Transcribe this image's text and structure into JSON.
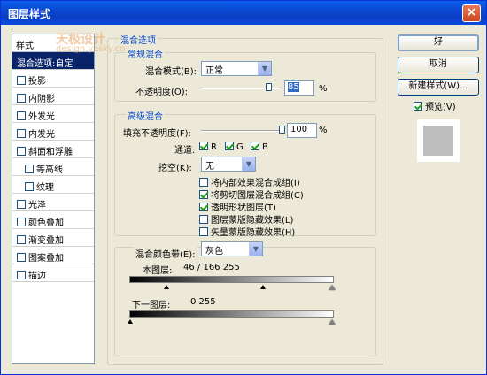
{
  "window": {
    "title": "图层样式",
    "close": "×"
  },
  "watermark": {
    "line1": "天极设计",
    "line2": "design.yesky.com"
  },
  "styles_panel": {
    "header": "样式",
    "items": [
      {
        "label": "混合选项:自定",
        "checkbox": false,
        "selected": true,
        "sub": false
      },
      {
        "label": "投影",
        "checkbox": true,
        "checked": false,
        "sub": false
      },
      {
        "label": "内阴影",
        "checkbox": true,
        "checked": false,
        "sub": false
      },
      {
        "label": "外发光",
        "checkbox": true,
        "checked": false,
        "sub": false
      },
      {
        "label": "内发光",
        "checkbox": true,
        "checked": false,
        "sub": false
      },
      {
        "label": "斜面和浮雕",
        "checkbox": true,
        "checked": false,
        "sub": false
      },
      {
        "label": "等高线",
        "checkbox": true,
        "checked": false,
        "sub": true
      },
      {
        "label": "纹理",
        "checkbox": true,
        "checked": false,
        "sub": true
      },
      {
        "label": "光泽",
        "checkbox": true,
        "checked": false,
        "sub": false
      },
      {
        "label": "颜色叠加",
        "checkbox": true,
        "checked": false,
        "sub": false
      },
      {
        "label": "渐变叠加",
        "checkbox": true,
        "checked": false,
        "sub": false
      },
      {
        "label": "图案叠加",
        "checkbox": true,
        "checked": false,
        "sub": false
      },
      {
        "label": "描边",
        "checkbox": true,
        "checked": false,
        "sub": false
      }
    ]
  },
  "blending": {
    "group_title": "混合选项",
    "general": {
      "title": "常规混合",
      "mode_label": "混合模式(B):",
      "mode_value": "正常",
      "opacity_label": "不透明度(O):",
      "opacity_value": "85",
      "opacity_unit": "%"
    },
    "advanced": {
      "title": "高级混合",
      "fill_label": "填充不透明度(F):",
      "fill_value": "100",
      "fill_unit": "%",
      "channels_label": "通道:",
      "channels": [
        {
          "label": "R",
          "checked": true
        },
        {
          "label": "G",
          "checked": true
        },
        {
          "label": "B",
          "checked": true
        }
      ],
      "knockout_label": "挖空(K):",
      "knockout_value": "无",
      "options": [
        {
          "label": "将内部效果混合成组(I)",
          "checked": false
        },
        {
          "label": "将剪切图层混合成组(C)",
          "checked": true
        },
        {
          "label": "透明形状图层(T)",
          "checked": true
        },
        {
          "label": "图层蒙版隐藏效果(L)",
          "checked": false
        },
        {
          "label": "矢量蒙版隐藏效果(H)",
          "checked": false
        }
      ]
    },
    "blend_if": {
      "label": "混合颜色带(E):",
      "value": "灰色",
      "this_layer_label": "本图层:",
      "this_layer_values": "46 / 166   255",
      "underlying_label": "下一图层:",
      "underlying_values": "0          255"
    }
  },
  "buttons": {
    "ok": "好",
    "cancel": "取消",
    "new_style": "新建样式(W)...",
    "preview_label": "预览(V)"
  }
}
